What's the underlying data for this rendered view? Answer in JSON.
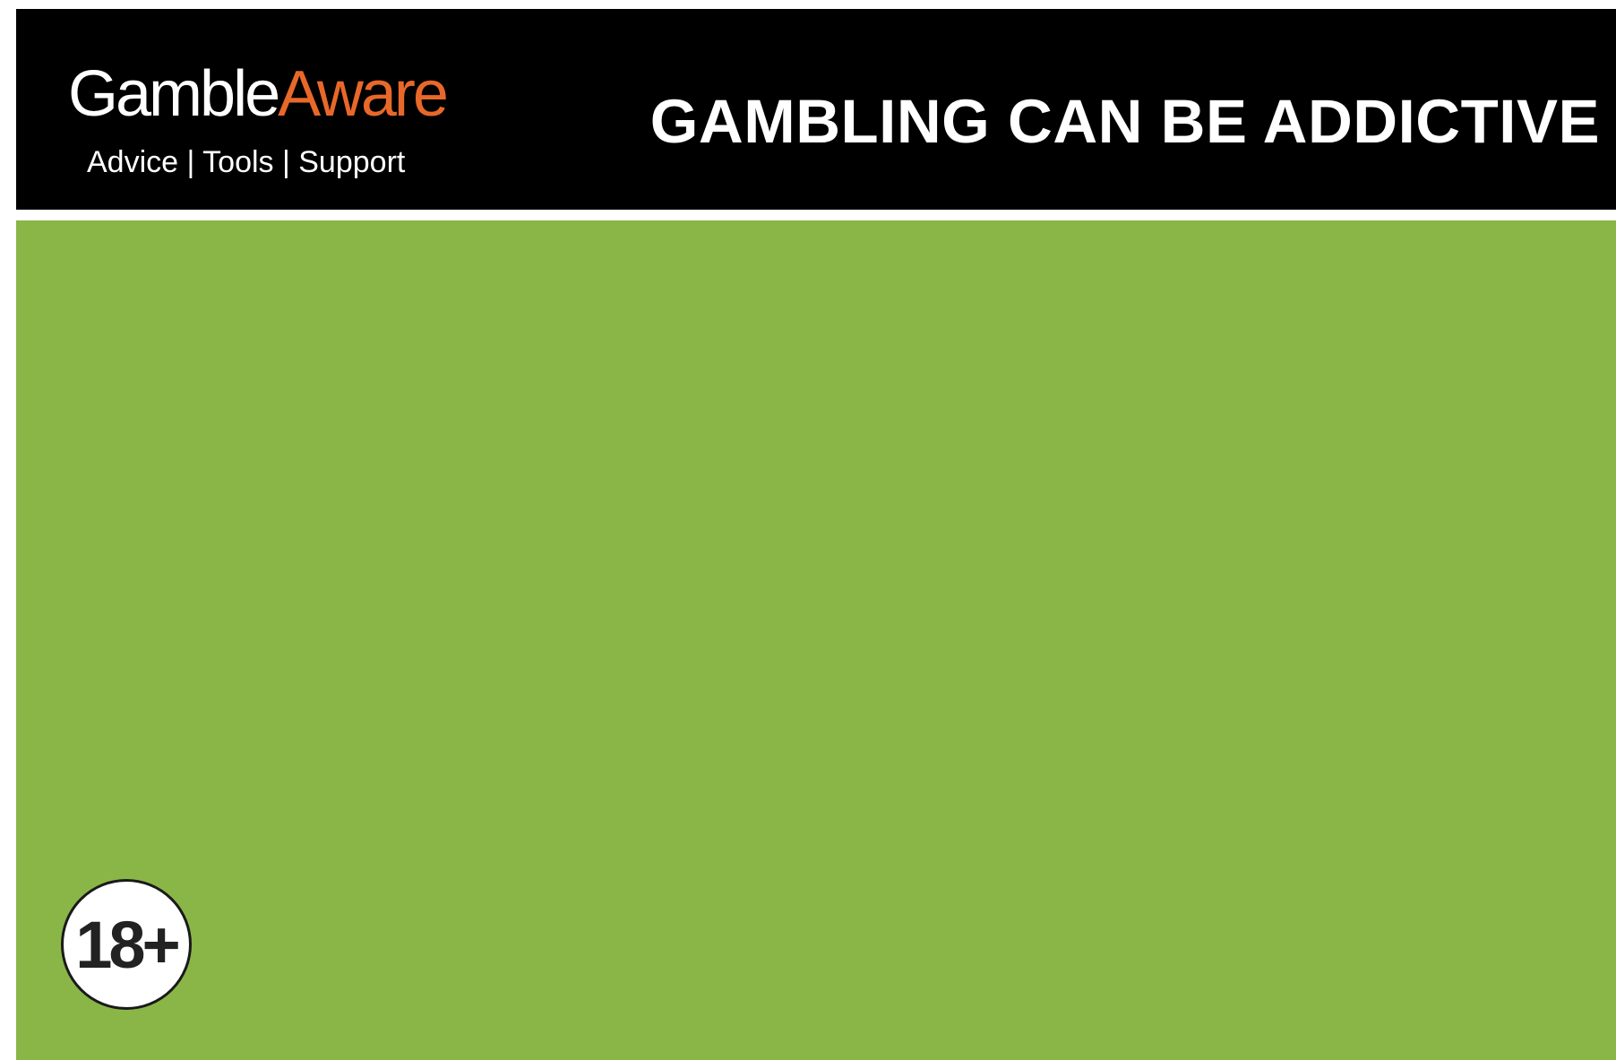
{
  "logo": {
    "name_part1": "Gamble",
    "name_part2": "Aware",
    "tagline": "Advice | Tools | Support"
  },
  "warning": {
    "title": "GAMBLING CAN BE ADDICTIVE"
  },
  "age_badge": {
    "label": "18+"
  },
  "colors": {
    "header_background": "#000000",
    "logo_primary": "#ffffff",
    "logo_accent": "#e8682a",
    "panel_background": "#8ab648",
    "badge_background": "#ffffff",
    "badge_text": "#222222"
  }
}
